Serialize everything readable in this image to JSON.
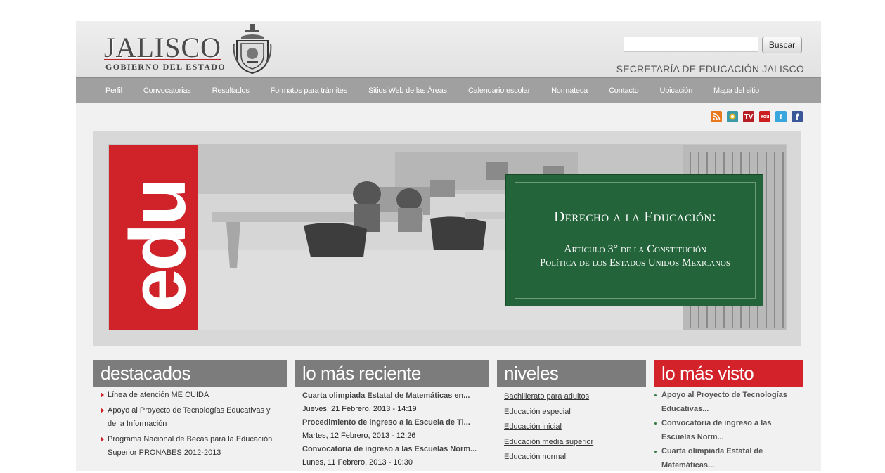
{
  "header": {
    "logo_title": "JALISCO",
    "logo_subtitle": "GOBIERNO DEL ESTADO",
    "search_button": "Buscar",
    "search_value": "",
    "secretaria": "SECRETARÍA DE EDUCACIÓN JALISCO"
  },
  "nav": {
    "items": [
      "Perfil",
      "Convocatorias",
      "Resultados",
      "Formatos para trámites",
      "Sitios Web de las Áreas",
      "Calendario escolar",
      "Normateca",
      "Contacto",
      "Ubicación",
      "Mapa del sitio"
    ]
  },
  "social": {
    "icons": [
      "rss-icon",
      "web-icon",
      "tv-icon",
      "youtube-icon",
      "twitter-icon",
      "facebook-icon"
    ],
    "tv_label": "TV",
    "youtube_label": "You",
    "twitter_label": "t",
    "facebook_label": "f"
  },
  "banner": {
    "edu_text": "edu",
    "title": "Derecho a la Educación:",
    "line1": "Artículo 3° de la Constitución",
    "line2": "Política de los Estados Unidos Mexicanos"
  },
  "columns": {
    "destacados": {
      "title": "destacados",
      "items": [
        "Línea de atención ME CUIDA",
        "Apoyo al Proyecto de Tecnologías Educativas y de la Información",
        "Programa Nacional de Becas para la Educación Superior PRONABES 2012-2013"
      ]
    },
    "reciente": {
      "title": "lo más reciente",
      "items": [
        {
          "title": "Cuarta olimpiada Estatal de Matemáticas en...",
          "date": "Jueves, 21 Febrero, 2013 - 14:19"
        },
        {
          "title": "Procedimiento de ingreso a la Escuela de Ti...",
          "date": "Martes, 12 Febrero, 2013 - 12:26"
        },
        {
          "title": "Convocatoria de ingreso a las Escuelas Norm...",
          "date": "Lunes, 11 Febrero, 2013 - 10:30"
        }
      ]
    },
    "niveles": {
      "title": "niveles",
      "items": [
        "Bachillerato para adultos",
        "Educación especial",
        "Educación inicial",
        "Educación media superior",
        "Educación normal"
      ]
    },
    "visto": {
      "title": "lo más visto",
      "items": [
        "Apoyo al Proyecto de Tecnologías Educativas...",
        "Convocatoria de ingreso a las Escuelas Norm...",
        "Cuarta olimpiada Estatal de Matemáticas..."
      ]
    }
  },
  "colors": {
    "accent_red": "#d3222a",
    "nav_gray": "#a0a0a0",
    "banner_green": "#23643a"
  }
}
